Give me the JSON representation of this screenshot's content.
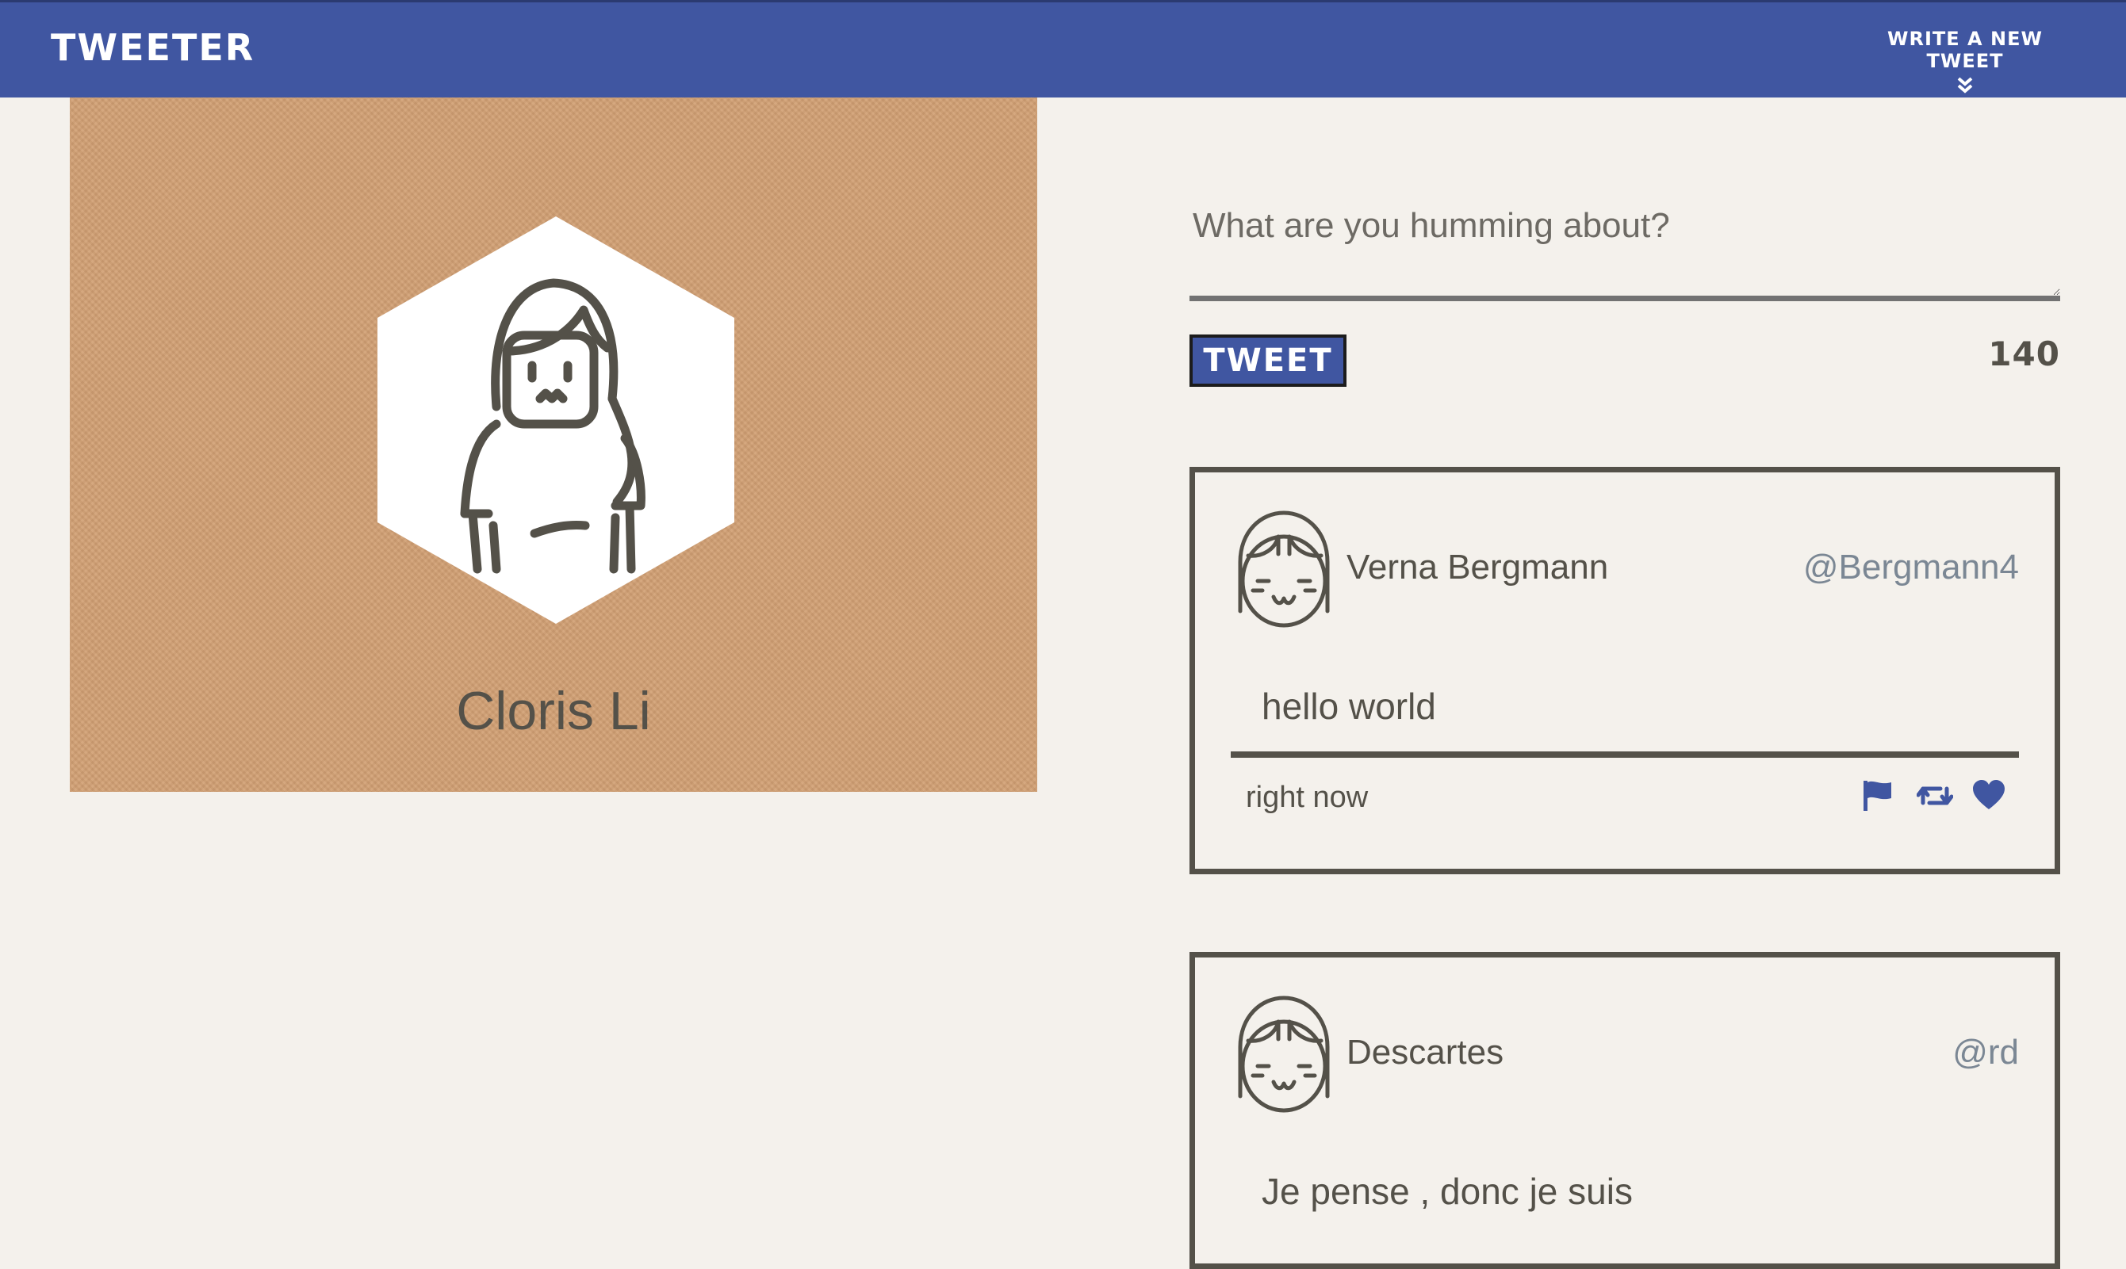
{
  "nav": {
    "brand": "TWEETER",
    "compose_label": "WRITE A NEW TWEET"
  },
  "profile": {
    "name": "Cloris Li"
  },
  "composer": {
    "placeholder": "What are you humming about?",
    "value": "",
    "submit_label": "TWEET",
    "char_counter": "140"
  },
  "tweets": [
    {
      "name": "Verna Bergmann",
      "handle": "@Bergmann4",
      "text": "hello world",
      "time": "right now",
      "actions": [
        "flag-icon",
        "retweet-icon",
        "heart-icon"
      ]
    },
    {
      "name": "Descartes",
      "handle": "@rd",
      "text": "Je pense , donc je suis"
    }
  ],
  "colors": {
    "nav_bg": "#4056a1",
    "page_bg": "#f4f1ec",
    "profile_bg": "#d19f73",
    "text": "#545149",
    "handle": "#7b8794",
    "accent": "#4056a1"
  }
}
